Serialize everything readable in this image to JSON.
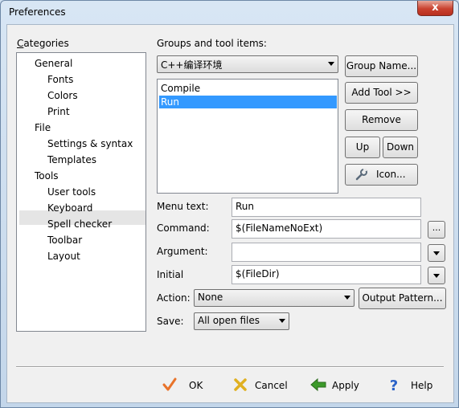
{
  "window": {
    "title": "Preferences",
    "close_glyph": "x"
  },
  "categories": {
    "label": "Categories",
    "items": [
      {
        "label": "General",
        "level": 1
      },
      {
        "label": "Fonts",
        "level": 2
      },
      {
        "label": "Colors",
        "level": 2
      },
      {
        "label": "Print",
        "level": 2
      },
      {
        "label": "File",
        "level": 1
      },
      {
        "label": "Settings & syntax",
        "level": 2
      },
      {
        "label": "Templates",
        "level": 2
      },
      {
        "label": "Tools",
        "level": 1
      },
      {
        "label": "User tools",
        "level": 2,
        "selected": true
      },
      {
        "label": "Keyboard",
        "level": 2
      },
      {
        "label": "Spell checker",
        "level": 2
      },
      {
        "label": "Toolbar",
        "level": 2
      },
      {
        "label": "Layout",
        "level": 2
      }
    ]
  },
  "groups": {
    "label": "Groups and tool items:",
    "selected_group": "C++编译环境",
    "tool_items": [
      {
        "label": "Compile",
        "selected": false
      },
      {
        "label": "Run",
        "selected": true
      }
    ]
  },
  "side_buttons": {
    "group_name": "Group Name...",
    "add_tool": "Add Tool >>",
    "remove": "Remove",
    "up": "Up",
    "down": "Down",
    "icon": "Icon..."
  },
  "fields": {
    "menu_text": {
      "label": "Menu text:",
      "value": "Run"
    },
    "command": {
      "label": "Command:",
      "value": "$(FileNameNoExt)",
      "browse": "..."
    },
    "argument": {
      "label": "Argument:",
      "value": ""
    },
    "initial": {
      "label": "Initial",
      "value": "$(FileDir)"
    },
    "action": {
      "label": "Action:",
      "value": "None"
    },
    "output_pattern": "Output Pattern...",
    "save": {
      "label": "Save:",
      "value": "All open files"
    }
  },
  "dialog_buttons": {
    "ok": "OK",
    "cancel": "Cancel",
    "apply": "Apply",
    "help": "Help"
  },
  "colors": {
    "selection": "#3399ff",
    "ok_icon": "#e8732a",
    "cancel_icon": "#e0b020",
    "apply_icon": "#3c9a2a",
    "help_icon": "#2a62c8"
  }
}
